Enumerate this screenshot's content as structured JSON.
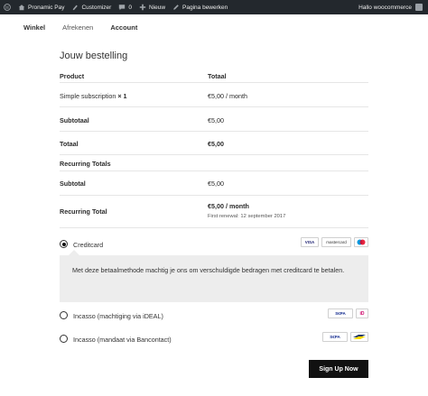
{
  "adminbar": {
    "site_name": "Pronamic Pay",
    "customizer": "Customizer",
    "comments_count": "0",
    "new_label": "Nieuw",
    "edit_page": "Pagina bewerken",
    "greeting": "Hallo woocommerce"
  },
  "nav": {
    "shop": "Winkel",
    "checkout": "Afrekenen",
    "account": "Account"
  },
  "order": {
    "title": "Jouw bestelling",
    "col_product": "Product",
    "col_total": "Totaal",
    "item_name": "Simple subscription",
    "item_qty": "× 1",
    "item_total": "€5,00 / month",
    "subtotal_label": "Subtotaal",
    "subtotal_value": "€5,00",
    "total_label": "Totaal",
    "total_value": "€5,00",
    "recurring_heading": "Recurring Totals",
    "r_subtotal_label": "Subtotal",
    "r_subtotal_value": "€5,00",
    "r_total_label": "Recurring Total",
    "r_total_value": "€5,00 / month",
    "first_renewal": "First renewal: 12 september 2017"
  },
  "payment": {
    "creditcard_label": "Creditcard",
    "creditcard_description": "Met deze betaalmethode machtig je ons om verschuldigde bedragen met creditcard te betalen.",
    "ideal_label": "Incasso (machtiging via iDEAL)",
    "bancontact_label": "Incasso (mandaat via Bancontact)",
    "logos": {
      "visa": "VISA",
      "mastercard": "mastercard",
      "maestro": "Maestro",
      "sepa": "S€PA",
      "ideal": "iD",
      "bancontact": "BC"
    },
    "selected": "creditcard"
  },
  "signup_button": "Sign Up Now",
  "colors": {
    "adminbar": "#23282d",
    "button": "#111111",
    "panel": "#ededed"
  }
}
